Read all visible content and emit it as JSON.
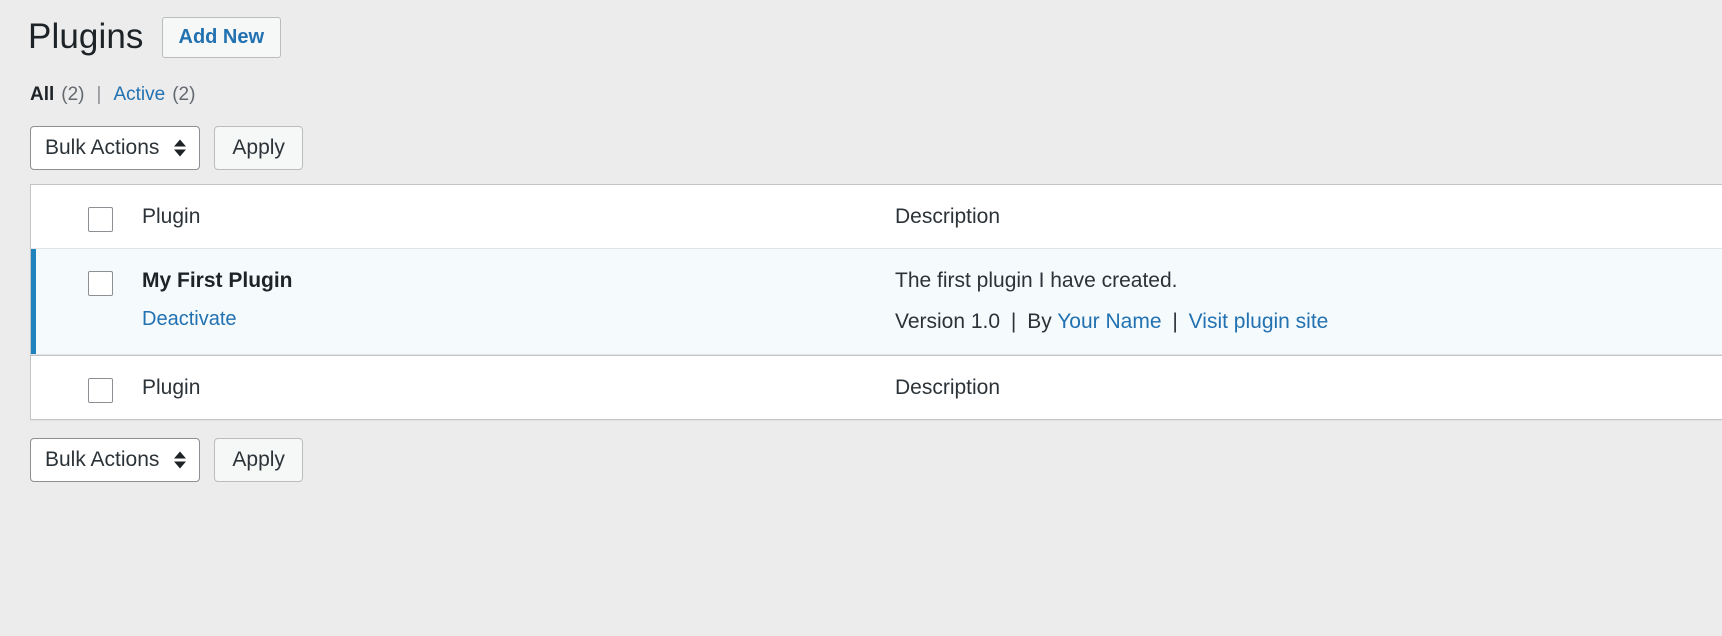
{
  "header": {
    "title": "Plugins",
    "add_new_label": "Add New"
  },
  "filters": {
    "all_label": "All",
    "all_count": "(2)",
    "separator": "|",
    "active_label": "Active",
    "active_count": "(2)"
  },
  "tablenav": {
    "bulk_actions_label": "Bulk Actions",
    "apply_label": "Apply"
  },
  "table": {
    "columns": {
      "plugin": "Plugin",
      "description": "Description"
    },
    "rows": [
      {
        "name": "My First Plugin",
        "action_label": "Deactivate",
        "description": "The first plugin I have created.",
        "version_text": "Version 1.0",
        "by_text": "By",
        "author": "Your Name",
        "site_link": "Visit plugin site",
        "separator": "|",
        "status": "active"
      }
    ]
  },
  "colors": {
    "accent": "#2271b1",
    "active_bar": "#2083bd",
    "active_row_bg": "#f5fafd",
    "page_bg": "#ececec"
  }
}
